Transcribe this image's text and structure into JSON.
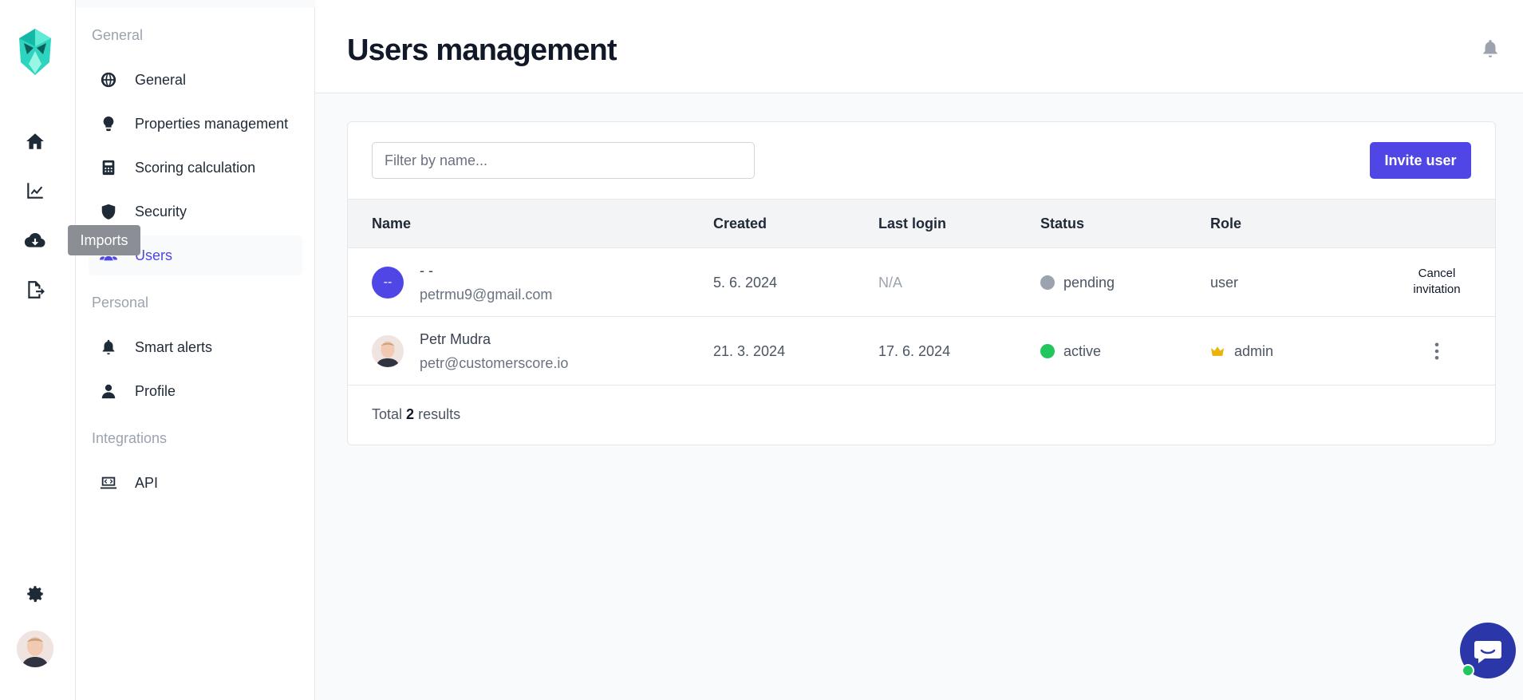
{
  "rail": {
    "tooltip": "Imports",
    "icons": [
      "home-icon",
      "chart-line-icon",
      "cloud-download-icon",
      "file-export-icon",
      "gear-icon"
    ]
  },
  "sidebar": {
    "sections": [
      {
        "title": "General",
        "items": [
          {
            "label": "General",
            "icon": "globe-icon"
          },
          {
            "label": "Properties management",
            "icon": "lightbulb-icon"
          },
          {
            "label": "Scoring calculation",
            "icon": "calculator-icon"
          },
          {
            "label": "Security",
            "icon": "shield-icon"
          },
          {
            "label": "Users",
            "icon": "users-icon",
            "active": true
          }
        ]
      },
      {
        "title": "Personal",
        "items": [
          {
            "label": "Smart alerts",
            "icon": "bell-icon"
          },
          {
            "label": "Profile",
            "icon": "user-icon"
          }
        ]
      },
      {
        "title": "Integrations",
        "items": [
          {
            "label": "API",
            "icon": "code-laptop-icon"
          }
        ]
      }
    ]
  },
  "header": {
    "title": "Users management"
  },
  "toolbar": {
    "filter_placeholder": "Filter by name...",
    "invite_label": "Invite user"
  },
  "table": {
    "columns": [
      "Name",
      "Created",
      "Last login",
      "Status",
      "Role"
    ],
    "rows": [
      {
        "initials": "--",
        "name": "- -",
        "email": "petrmu9@gmail.com",
        "created": "5. 6. 2024",
        "last_login": "N/A",
        "status": "pending",
        "role": "user",
        "action": "Cancel invitation"
      },
      {
        "initials": "",
        "name": "Petr Mudra",
        "email": "petr@customerscore.io",
        "created": "21. 3. 2024",
        "last_login": "17. 6. 2024",
        "status": "active",
        "role": "admin",
        "action": ""
      }
    ]
  },
  "footer": {
    "total_prefix": "Total",
    "total_count": "2",
    "total_suffix": "results"
  },
  "colors": {
    "accent": "#4f46e5",
    "pending": "#9ca3af",
    "active": "#22c55e",
    "logo": "#2dd4bf",
    "crown": "#eab308"
  }
}
